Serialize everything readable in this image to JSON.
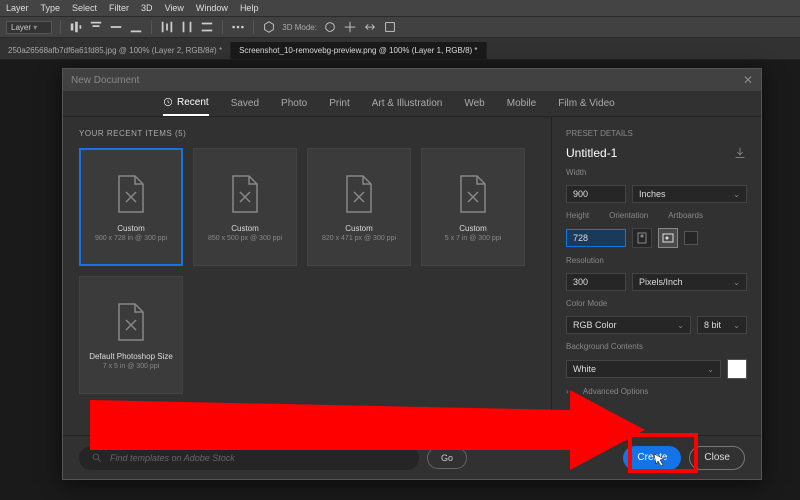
{
  "menubar": [
    "Layer",
    "Type",
    "Select",
    "Filter",
    "3D",
    "View",
    "Window",
    "Help"
  ],
  "optbar": {
    "layer_label": "Layer",
    "mode_label": "3D Mode:"
  },
  "tabs": [
    {
      "label": "250a26568afb7df6a61fd85.jpg @ 100% (Layer 2, RGB/8#) *"
    },
    {
      "label": "Screenshot_10-removebg-preview.png @ 100% (Layer 1, RGB/8) *",
      "active": true
    }
  ],
  "dialog": {
    "title": "New Document",
    "tabs": [
      "Recent",
      "Saved",
      "Photo",
      "Print",
      "Art & Illustration",
      "Web",
      "Mobile",
      "Film & Video"
    ],
    "active_tab": 0,
    "recent_header": "YOUR RECENT ITEMS",
    "recent_count": "(5)",
    "cards": [
      {
        "name": "Custom",
        "detail": "900 x 728 in @ 300 ppi",
        "selected": true
      },
      {
        "name": "Custom",
        "detail": "850 x 500 px @ 300 ppi"
      },
      {
        "name": "Custom",
        "detail": "820 x 471 px @ 300 ppi"
      },
      {
        "name": "Custom",
        "detail": "5 x 7 in @ 300 ppi"
      },
      {
        "name": "Default Photoshop Size",
        "detail": "7 x 5 in @ 300 ppi"
      }
    ],
    "details": {
      "header": "PRESET DETAILS",
      "name": "Untitled-1",
      "width_label": "Width",
      "width": "900",
      "width_unit": "Inches",
      "height_label": "Height",
      "height": "728",
      "orientation_label": "Orientation",
      "artboards_label": "Artboards",
      "resolution_label": "Resolution",
      "resolution": "300",
      "resolution_unit": "Pixels/Inch",
      "colormode_label": "Color Mode",
      "colormode": "RGB Color",
      "bitdepth": "8 bit",
      "bg_label": "Background Contents",
      "bg": "White",
      "advanced": "Advanced Options"
    },
    "footer": {
      "search_placeholder": "Find templates on Adobe Stock",
      "go": "Go",
      "create": "Create",
      "close": "Close"
    }
  }
}
